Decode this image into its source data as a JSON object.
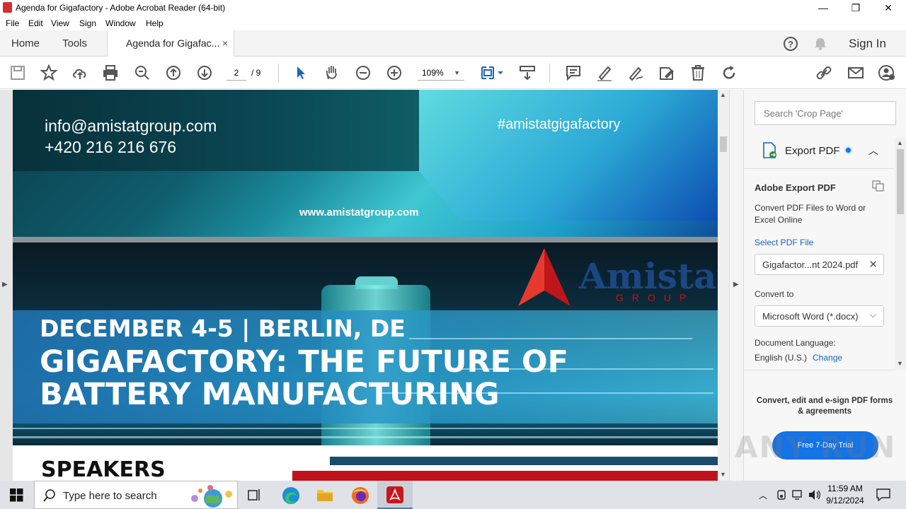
{
  "window": {
    "title": "Agenda for Gigafactory - Adobe Acrobat Reader (64-bit)",
    "minimize": "—",
    "maximize": "❐",
    "close": "✕"
  },
  "menu": [
    "File",
    "Edit",
    "View",
    "Sign",
    "Window",
    "Help"
  ],
  "tabs": {
    "home": "Home",
    "tools": "Tools",
    "doc": "Agenda for Gigafac...",
    "close": "×",
    "sign_in": "Sign In"
  },
  "toolbar": {
    "page_current": "2",
    "page_total": "/ 9",
    "zoom": "109%"
  },
  "document": {
    "page1": {
      "email": "info@amistatgroup.com",
      "phone": "+420 216 216 676",
      "hashtag": "#amistatgigafactory",
      "website": "www.amistatgroup.com"
    },
    "page2": {
      "logo_word": "Amistat",
      "logo_group": "GROUP",
      "date_line": "DECEMBER 4-5 | BERLIN, DE",
      "headline_1": "GIGAFACTORY: THE FUTURE OF",
      "headline_2": "BATTERY MANUFACTURING",
      "speakers": "SPEAKERS"
    }
  },
  "panel": {
    "search_placeholder": "Search 'Crop Page'",
    "export_title": "Export PDF",
    "section_title": "Adobe Export PDF",
    "description": "Convert PDF Files to Word or Excel Online",
    "select_label": "Select PDF File",
    "file_name": "Gigafactor...nt 2024.pdf",
    "convert_to_label": "Convert to",
    "convert_to_value": "Microsoft Word (*.docx)",
    "doc_lang_label": "Document Language:",
    "doc_lang_value": "English (U.S.)",
    "change_link": "Change",
    "promo": "Convert, edit and e-sign PDF forms & agreements",
    "trial_button": "Free 7-Day Trial"
  },
  "taskbar": {
    "search_placeholder": "Type here to search",
    "time": "11:59 AM",
    "date": "9/12/2024"
  },
  "watermark": "ANY RUN",
  "colors": {
    "accent_blue": "#1473e6",
    "pdf_red": "#d32f2f",
    "link_blue": "#1a64b8"
  }
}
